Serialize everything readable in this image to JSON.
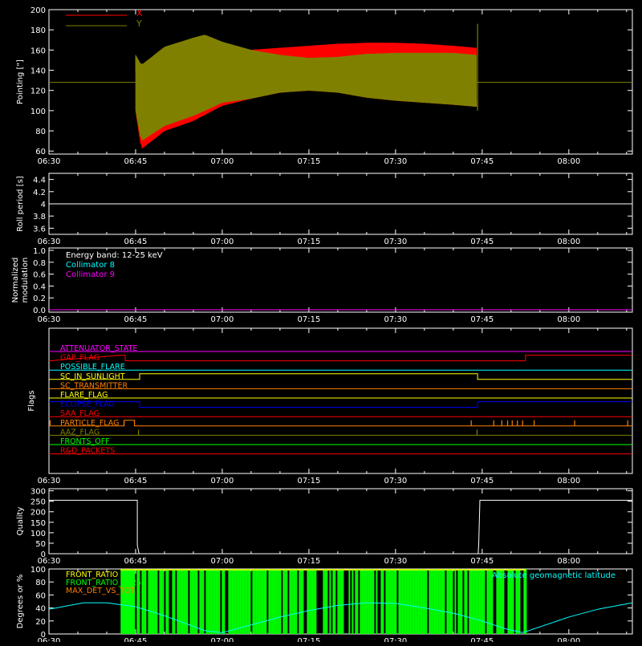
{
  "time_axis": {
    "range_min": [
      390,
      491
    ],
    "ticks": [
      "06:30",
      "06:45",
      "07:00",
      "07:15",
      "07:30",
      "07:45",
      "08:00"
    ],
    "tick_min": [
      390,
      405,
      420,
      435,
      450,
      465,
      480
    ]
  },
  "colors": {
    "background": "#000000",
    "axes": "#ffffff",
    "x_pointing": "#ff0000",
    "y_pointing": "#808000",
    "collimator8": "#00ffff",
    "collimator9": "#ff00ff",
    "front_ratio": "#ffff00",
    "front_ratio_1225": "#00ff00",
    "max_det_vs_tot": "#ff8000",
    "geomag": "#00ffff"
  },
  "chart_data": [
    {
      "id": "pointing",
      "type": "line",
      "ylabel": "Pointing [\"]",
      "ylim": [
        57,
        200
      ],
      "yticks": [
        60,
        80,
        100,
        120,
        140,
        160,
        180,
        200
      ],
      "legend_placement": "top-left",
      "series": [
        {
          "name": "X",
          "color": "#ff0000",
          "envelope_x_min": [
            405,
            406,
            410,
            415,
            420,
            425,
            430,
            435,
            440,
            445,
            450,
            455,
            460,
            464
          ],
          "upper": [
            150,
            140,
            150,
            158,
            158,
            160,
            162,
            164,
            166,
            167,
            167,
            166,
            164,
            162
          ],
          "lower": [
            100,
            62,
            80,
            90,
            105,
            112,
            118,
            120,
            118,
            113,
            110,
            108,
            106,
            104
          ]
        },
        {
          "name": "Y",
          "color": "#808000",
          "envelope_x_min": [
            405,
            406,
            410,
            415,
            417,
            420,
            425,
            430,
            435,
            440,
            445,
            450,
            455,
            460,
            464
          ],
          "upper": [
            155,
            145,
            163,
            172,
            175,
            168,
            160,
            155,
            152,
            153,
            156,
            157,
            157,
            157,
            155
          ],
          "lower": [
            100,
            70,
            85,
            95,
            100,
            108,
            112,
            118,
            120,
            118,
            113,
            110,
            108,
            106,
            104
          ],
          "baseline": 128,
          "spike": {
            "x_min": 464.2,
            "top": 186,
            "bottom": 100
          }
        }
      ]
    },
    {
      "id": "roll",
      "type": "line",
      "ylabel": "Roll period [s]",
      "ylim": [
        3.5,
        4.5
      ],
      "yticks": [
        3.6,
        3.8,
        4.0,
        4.2,
        4.4
      ],
      "series": [
        {
          "color": "#ffffff",
          "x_min": [
            390,
            491
          ],
          "values": [
            4.0,
            4.0
          ]
        }
      ]
    },
    {
      "id": "modulation",
      "type": "line",
      "ylabel": "Normalized modulation",
      "ylim": [
        -0.04,
        1.04
      ],
      "yticks": [
        0.0,
        0.2,
        0.4,
        0.6,
        0.8,
        1.0
      ],
      "ytick_labels": [
        "0.0",
        "0.2",
        "0.4",
        "0.6",
        "0.8",
        "1.0"
      ],
      "legend_placement": "top-left",
      "annotations": [
        "Energy band: 12-25 keV"
      ],
      "series": [
        {
          "name": "Collimator 8",
          "color": "#00ffff",
          "x_min": [
            390,
            491
          ],
          "values": [
            0,
            0
          ]
        },
        {
          "name": "Collimator 9",
          "color": "#ff00ff",
          "x_min": [
            390,
            491
          ],
          "values": [
            0,
            0
          ]
        }
      ]
    },
    {
      "id": "flags",
      "type": "line",
      "ylabel": "Flags",
      "flags": [
        {
          "name": "ATTENUATOR_STATE",
          "color": "#ff00ff",
          "steps": [
            [
              390,
              0
            ],
            [
              491,
              0
            ]
          ]
        },
        {
          "name": "GAP_FLAG",
          "color": "#ff0000",
          "steps": [
            [
              390,
              0
            ],
            [
              402.5,
              1
            ],
            [
              403.2,
              1
            ],
            [
              403.2,
              0
            ],
            [
              472.5,
              0
            ],
            [
              472.5,
              1
            ],
            [
              491,
              1
            ]
          ]
        },
        {
          "name": "POSSIBLE_FLARE",
          "color": "#00ffff",
          "steps": [
            [
              390,
              0
            ],
            [
              491,
              0
            ]
          ]
        },
        {
          "name": "SC_IN_SUNLIGHT",
          "color": "#ffff00",
          "steps": [
            [
              390,
              0
            ],
            [
              405.7,
              0
            ],
            [
              405.7,
              1
            ],
            [
              464.2,
              1
            ],
            [
              464.2,
              0
            ],
            [
              491,
              0
            ]
          ]
        },
        {
          "name": "SC_TRANSMITTER",
          "color": "#ff8000",
          "steps": [
            [
              390,
              0
            ],
            [
              491,
              0
            ]
          ]
        },
        {
          "name": "FLARE_FLAG",
          "color": "#ffff00",
          "steps": [
            [
              390,
              0
            ],
            [
              491,
              0
            ]
          ]
        },
        {
          "name": "ECLIPSE_FLAG",
          "color": "#0000ff",
          "steps": [
            [
              390,
              1
            ],
            [
              405.7,
              1
            ],
            [
              405.7,
              0
            ],
            [
              464.2,
              0
            ],
            [
              464.2,
              1
            ],
            [
              491,
              1
            ]
          ]
        },
        {
          "name": "SAA_FLAG",
          "color": "#ff0000",
          "steps": [
            [
              390,
              0
            ],
            [
              491,
              0
            ]
          ]
        },
        {
          "name": "PARTICLE_FLAG",
          "color": "#ff8000",
          "steps": [
            [
              390,
              0
            ],
            [
              403,
              0
            ],
            [
              403,
              1
            ],
            [
              404.8,
              1
            ],
            [
              404.8,
              0
            ],
            [
              491,
              0
            ]
          ],
          "pulses_min": [
            390.2,
            403,
            404.8,
            463.1,
            467,
            468.4,
            469.4,
            470.2,
            471.1,
            472.0,
            474.0,
            481.0,
            490.2
          ]
        },
        {
          "name": "AAZ_FLAG",
          "color": "#808000",
          "steps": [
            [
              390,
              0
            ],
            [
              491,
              0
            ]
          ],
          "pulses_min": [
            405.5,
            464.1
          ]
        },
        {
          "name": "FRONTS_OFF",
          "color": "#00ff00",
          "steps": [
            [
              390,
              0
            ],
            [
              491,
              0
            ]
          ]
        },
        {
          "name": "R&D_PACKETS",
          "color": "#ff0000",
          "steps": [
            [
              390,
              0
            ],
            [
              491,
              0
            ]
          ]
        }
      ]
    },
    {
      "id": "quality",
      "type": "line",
      "ylabel": "Quality",
      "ylim": [
        0,
        310
      ],
      "yticks": [
        0,
        50,
        100,
        150,
        200,
        250,
        300
      ],
      "series": [
        {
          "color": "#ffffff",
          "x_min": [
            390,
            405.3,
            405.3,
            405.6,
            405.8,
            464.3,
            464.4,
            464.6,
            491
          ],
          "values": [
            255,
            255,
            40,
            0,
            0,
            0,
            40,
            255,
            255
          ]
        }
      ]
    },
    {
      "id": "ratios",
      "type": "area",
      "ylabel": "Degrees or %",
      "ylim": [
        0,
        100
      ],
      "yticks": [
        0,
        20,
        40,
        60,
        80,
        100
      ],
      "legend_placement": "top-left",
      "series": [
        {
          "name": "FRONT_RATIO",
          "color": "#ffff00"
        },
        {
          "name": "FRONT_RATIO_1225",
          "color": "#00ff00",
          "block_x_min": [
            402.4,
            404.9
          ],
          "block_height": 100,
          "block2_x_min": [
            405.2,
            472.6
          ]
        },
        {
          "name": "MAX_DET_VS_TOT",
          "color": "#ff8000"
        },
        {
          "name": "Absolute geomagnetic latitude",
          "color": "#00ffff",
          "x_min": [
            390,
            396,
            400,
            405,
            410,
            414,
            417,
            420,
            425,
            430,
            435,
            440,
            445,
            450,
            455,
            460,
            465,
            469,
            472,
            476,
            480,
            485,
            491
          ],
          "values": [
            38,
            48,
            48,
            42,
            28,
            15,
            5,
            2,
            14,
            26,
            36,
            44,
            48,
            47,
            40,
            32,
            20,
            8,
            2,
            14,
            26,
            38,
            48
          ]
        }
      ]
    }
  ]
}
